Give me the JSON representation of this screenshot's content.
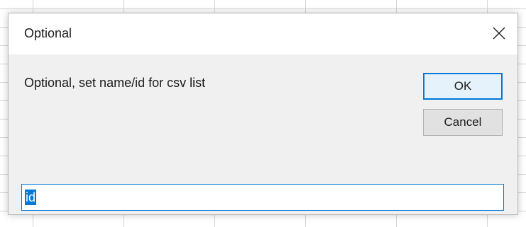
{
  "dialog": {
    "title": "Optional",
    "prompt": "Optional, set name/id for csv list",
    "ok_label": "OK",
    "cancel_label": "Cancel",
    "input_value": "id"
  },
  "icons": {
    "close": "close-icon"
  },
  "colors": {
    "accent": "#0078d7",
    "dialog_background": "#f0f0f0",
    "titlebar_background": "#ffffff",
    "button_background": "#e1e1e1"
  }
}
